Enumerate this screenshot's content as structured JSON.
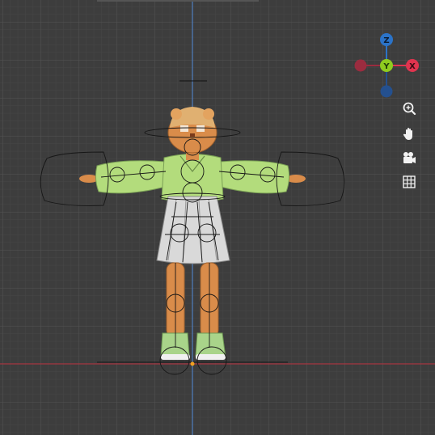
{
  "viewport": {
    "background": "#3d3d3d",
    "grid_color": "#505050",
    "x_axis_color": "#a53641",
    "z_axis_color": "#4f7fbf"
  },
  "gizmo": {
    "z_label": "Z",
    "y_label": "Y",
    "x_label": "X",
    "colors": {
      "z": "#2b73c8",
      "y": "#8fcc1f",
      "x": "#e0344f",
      "neg_x": "#9b2c3f",
      "neg_z": "#24508f"
    }
  },
  "nav_tools": [
    {
      "name": "zoom-icon"
    },
    {
      "name": "pan-hand-icon"
    },
    {
      "name": "camera-icon"
    },
    {
      "name": "ortho-grid-icon"
    }
  ],
  "character": {
    "skin_color": "#d98c4a",
    "shirt_color": "#b3dc7c",
    "skirt_color": "#d9d9d9",
    "shoe_color": "#a9d48a"
  }
}
